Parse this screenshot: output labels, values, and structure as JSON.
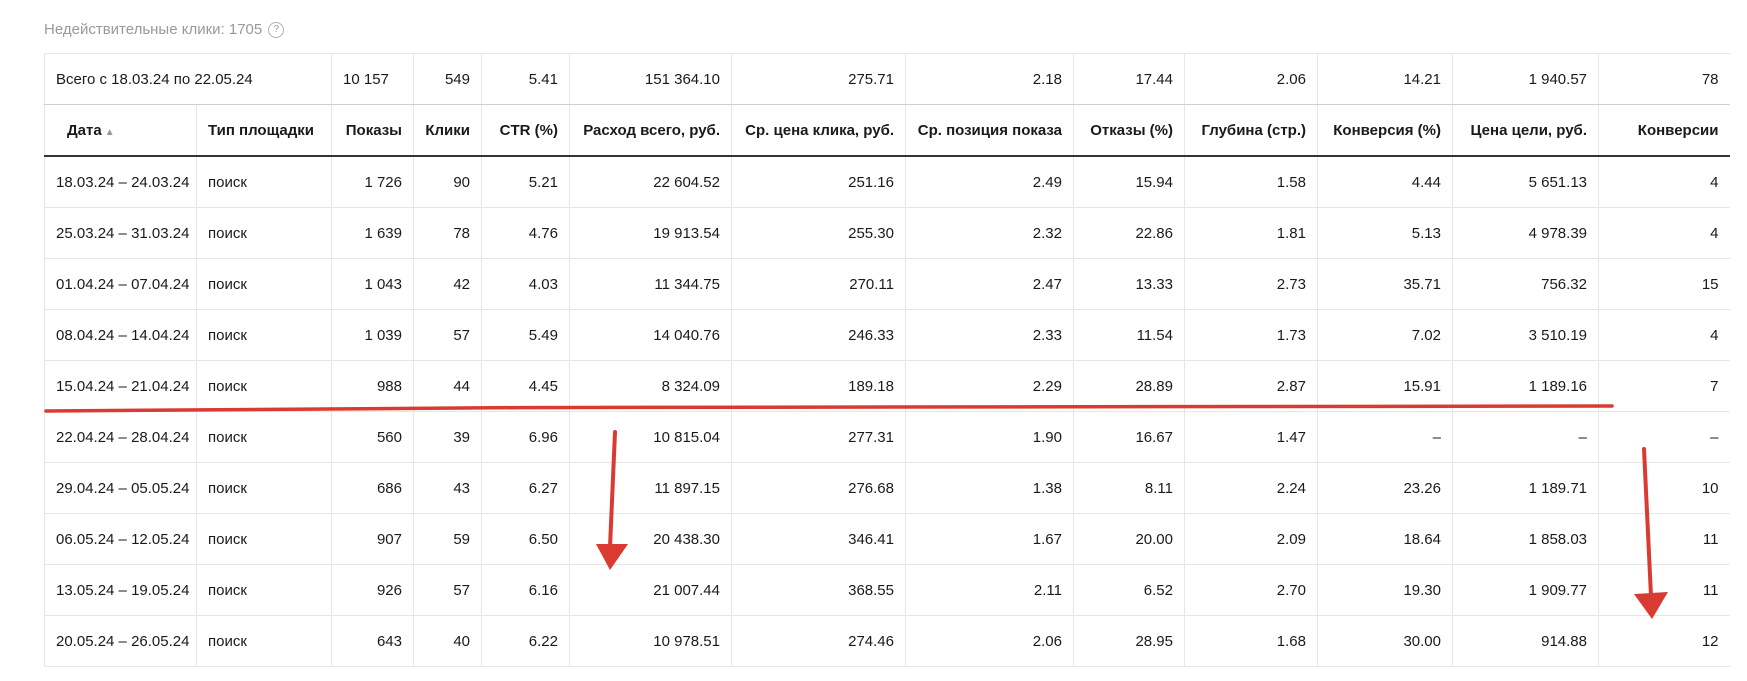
{
  "invalid_clicks": {
    "label": "Недействительные клики: 1705",
    "help_icon": "question-circle-icon"
  },
  "total": {
    "label": "Всего с 18.03.24 по 22.05.24",
    "values": [
      "10 157",
      "549",
      "5.41",
      "151 364.10",
      "275.71",
      "2.18",
      "17.44",
      "2.06",
      "14.21",
      "1 940.57",
      "78"
    ]
  },
  "columns": [
    {
      "label": "Дата",
      "sort": "▲"
    },
    {
      "label": "Тип площадки"
    },
    {
      "label": "Показы"
    },
    {
      "label": "Клики"
    },
    {
      "label": "CTR (%)"
    },
    {
      "label": "Расход всего, руб."
    },
    {
      "label": "Ср. цена клика, руб."
    },
    {
      "label": "Ср. позиция показа"
    },
    {
      "label": "Отказы (%)"
    },
    {
      "label": "Глубина (стр.)"
    },
    {
      "label": "Конверсия (%)"
    },
    {
      "label": "Цена цели, руб."
    },
    {
      "label": "Конверсии"
    }
  ],
  "rows": [
    [
      "18.03.24 – 24.03.24",
      "поиск",
      "1 726",
      "90",
      "5.21",
      "22 604.52",
      "251.16",
      "2.49",
      "15.94",
      "1.58",
      "4.44",
      "5 651.13",
      "4"
    ],
    [
      "25.03.24 – 31.03.24",
      "поиск",
      "1 639",
      "78",
      "4.76",
      "19 913.54",
      "255.30",
      "2.32",
      "22.86",
      "1.81",
      "5.13",
      "4 978.39",
      "4"
    ],
    [
      "01.04.24 – 07.04.24",
      "поиск",
      "1 043",
      "42",
      "4.03",
      "11 344.75",
      "270.11",
      "2.47",
      "13.33",
      "2.73",
      "35.71",
      "756.32",
      "15"
    ],
    [
      "08.04.24 – 14.04.24",
      "поиск",
      "1 039",
      "57",
      "5.49",
      "14 040.76",
      "246.33",
      "2.33",
      "11.54",
      "1.73",
      "7.02",
      "3 510.19",
      "4"
    ],
    [
      "15.04.24 – 21.04.24",
      "поиск",
      "988",
      "44",
      "4.45",
      "8 324.09",
      "189.18",
      "2.29",
      "28.89",
      "2.87",
      "15.91",
      "1 189.16",
      "7"
    ],
    [
      "22.04.24 – 28.04.24",
      "поиск",
      "560",
      "39",
      "6.96",
      "10 815.04",
      "277.31",
      "1.90",
      "16.67",
      "1.47",
      "–",
      "–",
      "–"
    ],
    [
      "29.04.24 – 05.05.24",
      "поиск",
      "686",
      "43",
      "6.27",
      "11 897.15",
      "276.68",
      "1.38",
      "8.11",
      "2.24",
      "23.26",
      "1 189.71",
      "10"
    ],
    [
      "06.05.24 – 12.05.24",
      "поиск",
      "907",
      "59",
      "6.50",
      "20 438.30",
      "346.41",
      "1.67",
      "20.00",
      "2.09",
      "18.64",
      "1 858.03",
      "11"
    ],
    [
      "13.05.24 – 19.05.24",
      "поиск",
      "926",
      "57",
      "6.16",
      "21 007.44",
      "368.55",
      "2.11",
      "6.52",
      "2.70",
      "19.30",
      "1 909.77",
      "11"
    ],
    [
      "20.05.24 – 26.05.24",
      "поиск",
      "643",
      "40",
      "6.22",
      "10 978.51",
      "274.46",
      "2.06",
      "28.95",
      "1.68",
      "30.00",
      "914.88",
      "12"
    ]
  ],
  "annotation_color": "#d93a32"
}
